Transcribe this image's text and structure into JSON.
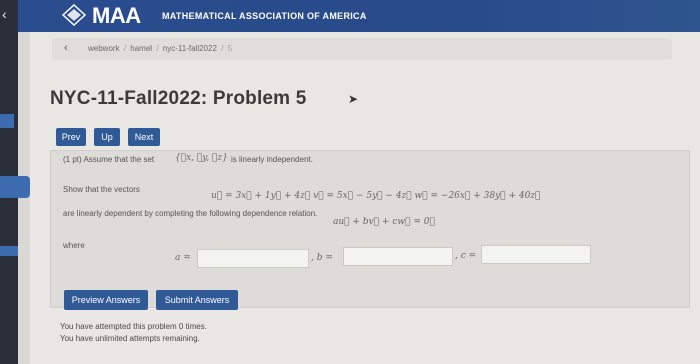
{
  "header": {
    "logo_text": "MAA",
    "org_name": "MATHEMATICAL ASSOCIATION OF AMERICA"
  },
  "breadcrumb": {
    "items": [
      "webwork",
      "hamel",
      "nyc-11-fall2022"
    ],
    "current": "5",
    "separator": "/"
  },
  "page": {
    "title": "NYC-11-Fall2022: Problem 5"
  },
  "nav": {
    "prev_label": "Prev",
    "up_label": "Up",
    "next_label": "Next"
  },
  "problem": {
    "intro": "(1 pt) Assume that the set",
    "set_math": "{⃗x, ⃗y, ⃗z}",
    "intro_end": "is linearly independent.",
    "show_text": "Show that the vectors",
    "vectors_math": "u⃗ = 3x⃗ + 1y⃗ + 4z⃗   v⃗ = 5x⃗ − 5y⃗ − 4z⃗   w⃗ = −26x⃗ + 38y⃗ + 40z⃗",
    "dependent_text": "are linearly dependent by completing the following dependence relation.",
    "relation_math": "au⃗ + bv⃗ + cw⃗ = 0⃗",
    "where_label": "where",
    "a_label": "a =",
    "b_label": ", b =",
    "c_label": ", c =",
    "a_value": "",
    "b_value": "",
    "c_value": ""
  },
  "actions": {
    "preview_label": "Preview Answers",
    "submit_label": "Submit Answers"
  },
  "status": {
    "attempted": "You have attempted this problem 0 times.",
    "remaining": "You have unlimited attempts remaining."
  }
}
